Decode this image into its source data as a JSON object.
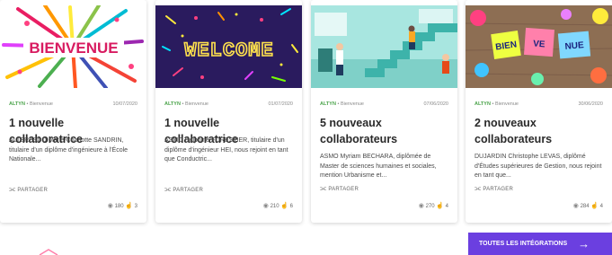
{
  "cards": [
    {
      "image_text": "BIENVENUE",
      "category": "ALTYN",
      "subcategory": "Bienvenue",
      "date": "10/07/2020",
      "title": "1 nouvelle collaboratrice",
      "excerpt": "ALTERESCO Marie-Charlotte SANDRIN, titulaire d'un diplôme d'ingénieure à l'École Nationale...",
      "share_label": "PARTAGER",
      "views": "180",
      "likes": "3"
    },
    {
      "image_text": "WELCOME",
      "category": "ALTYN",
      "subcategory": "Bienvenue",
      "date": "01/07/2020",
      "title": "1 nouvelle collaboratrice",
      "excerpt": "ASMO Delphine FORESTIER, titulaire d'un diplôme d'ingénieur HEI, nous rejoint en tant que Conductric...",
      "share_label": "PARTAGER",
      "views": "210",
      "likes": "6"
    },
    {
      "image_text": "",
      "category": "ALTYN",
      "subcategory": "Bienvenue",
      "date": "07/06/2020",
      "title": "5 nouveaux collaborateurs",
      "excerpt": "ASMO Myriam BECHARA, diplômée de Master de sciences humaines et sociales, mention Urbanisme et...",
      "share_label": "PARTAGER",
      "views": "270",
      "likes": "4"
    },
    {
      "image_text": "BIENVENUE",
      "category": "ALTYN",
      "subcategory": "Bienvenue",
      "date": "30/06/2020",
      "title": "2 nouveaux collaborateurs",
      "excerpt": "DUJARDIN Christophe LEVAS, diplômé d'Études supérieures de Gestion, nous rejoint en tant que...",
      "share_label": "PARTAGER",
      "views": "284",
      "likes": "4"
    }
  ],
  "all_button": {
    "label": "TOUTES LES INTÉGRATIONS"
  },
  "colors": {
    "accent": "#6b3fe0",
    "category": "#4aa34a"
  }
}
